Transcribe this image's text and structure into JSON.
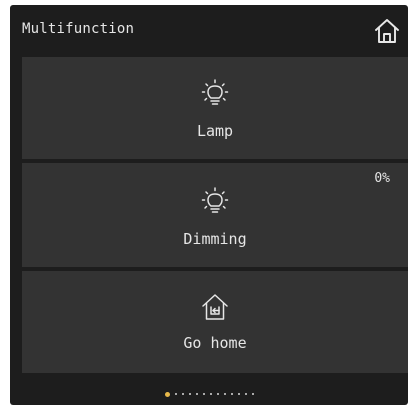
{
  "header": {
    "title": "Multifunction",
    "home_icon": "home-icon"
  },
  "tiles": [
    {
      "label": "Lamp",
      "icon": "lightbulb-icon",
      "value": null
    },
    {
      "label": "Dimming",
      "icon": "lightbulb-icon",
      "value": "0%"
    },
    {
      "label": "Go home",
      "icon": "go-home-icon",
      "value": null
    }
  ],
  "pager": {
    "total_pages": 13,
    "active_page": 1
  },
  "colors": {
    "background": "#1d1d1d",
    "tile": "#333333",
    "text": "#e6e6e6",
    "active_dot": "#e8b94a",
    "dot": "#d8d8d8"
  }
}
